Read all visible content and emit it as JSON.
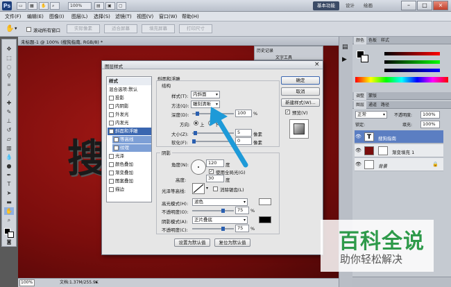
{
  "app": {
    "logo": "Ps",
    "zoom": "100%",
    "workspaces": [
      "基本功能",
      "设计",
      "绘画"
    ]
  },
  "menu": [
    "文件(F)",
    "编辑(E)",
    "图像(I)",
    "图层(L)",
    "选择(S)",
    "滤镜(T)",
    "视图(V)",
    "窗口(W)",
    "帮助(H)"
  ],
  "options": {
    "scroll_all": "滚动所有窗口",
    "buttons": [
      "实际像素",
      "适合屏幕",
      "填充屏幕",
      "打印尺寸"
    ]
  },
  "document": {
    "tab_title": "未标题-1 @ 100% (搜狗指南, RGB/8) *",
    "canvas_text": "搜",
    "status_zoom": "100%",
    "status_doc": "文档:1.37M/255.9K"
  },
  "history_panel": {
    "tab": "历史记录",
    "item": "文字工具"
  },
  "color_panel": {
    "tabs": [
      "颜色",
      "色板",
      "样式"
    ]
  },
  "adjust_panel": {
    "tabs": [
      "调整",
      "蒙版"
    ]
  },
  "layers_panel": {
    "tabs": [
      "图层",
      "通道",
      "路径"
    ],
    "blend_mode": "正常",
    "opacity_label": "不透明度:",
    "opacity": "100%",
    "lock_label": "锁定:",
    "fill_label": "填充:",
    "fill": "100%",
    "layers": [
      {
        "name": "搜狗指南",
        "type": "text"
      },
      {
        "name": "渐变填充 1",
        "type": "fill"
      },
      {
        "name": "背景",
        "type": "background"
      }
    ]
  },
  "dialog": {
    "title": "图层样式",
    "styles_header": "样式",
    "blend_options": "混合选项:默认",
    "styles": [
      {
        "label": "投影",
        "checked": false
      },
      {
        "label": "内阴影",
        "checked": false
      },
      {
        "label": "外发光",
        "checked": false
      },
      {
        "label": "内发光",
        "checked": false
      },
      {
        "label": "斜面和浮雕",
        "checked": true
      },
      {
        "label": "等高线",
        "checked": false
      },
      {
        "label": "纹理",
        "checked": false
      },
      {
        "label": "光泽",
        "checked": false
      },
      {
        "label": "颜色叠加",
        "checked": false
      },
      {
        "label": "渐变叠加",
        "checked": false
      },
      {
        "label": "图案叠加",
        "checked": false
      },
      {
        "label": "描边",
        "checked": false
      }
    ],
    "section_title": "斜面和浮雕",
    "structure": {
      "title": "结构",
      "style_label": "样式(T):",
      "style_value": "内斜面",
      "technique_label": "方法(Q):",
      "technique_value": "雕刻清晰",
      "depth_label": "深度(D):",
      "depth_value": "100",
      "depth_unit": "%",
      "direction_label": "方向:",
      "dir_up": "上",
      "dir_down": "下",
      "size_label": "大小(Z):",
      "size_value": "5",
      "size_unit": "像素",
      "soften_label": "软化(F):",
      "soften_value": "0",
      "soften_unit": "像素"
    },
    "shading": {
      "title": "阴影",
      "angle_label": "角度(N):",
      "angle_value": "120",
      "angle_unit": "度",
      "global_light": "使用全局光(G)",
      "altitude_label": "高度:",
      "altitude_value": "30",
      "altitude_unit": "度",
      "gloss_label": "光泽等高线:",
      "antialias": "消除锯齿(L)",
      "highlight_label": "高光模式(H):",
      "highlight_mode": "滤色",
      "hl_opacity_label": "不透明度(O):",
      "hl_opacity": "75",
      "shadow_label": "阴影模式(A):",
      "shadow_mode": "正片叠底",
      "sh_opacity_label": "不透明度(C):",
      "sh_opacity": "75",
      "pct": "%"
    },
    "make_default": "设置为默认值",
    "reset_default": "复位为默认值",
    "ok": "确定",
    "cancel": "取消",
    "new_style": "新建样式(W)...",
    "preview": "预览(V)"
  },
  "watermark": {
    "title": "百科全说",
    "subtitle": "助你轻松解决"
  },
  "colors": {
    "accent": "#3a66b0",
    "arrow": "#1e9ad8",
    "canvas": "#7a0d0c",
    "watermark": "#2e9a4a"
  }
}
